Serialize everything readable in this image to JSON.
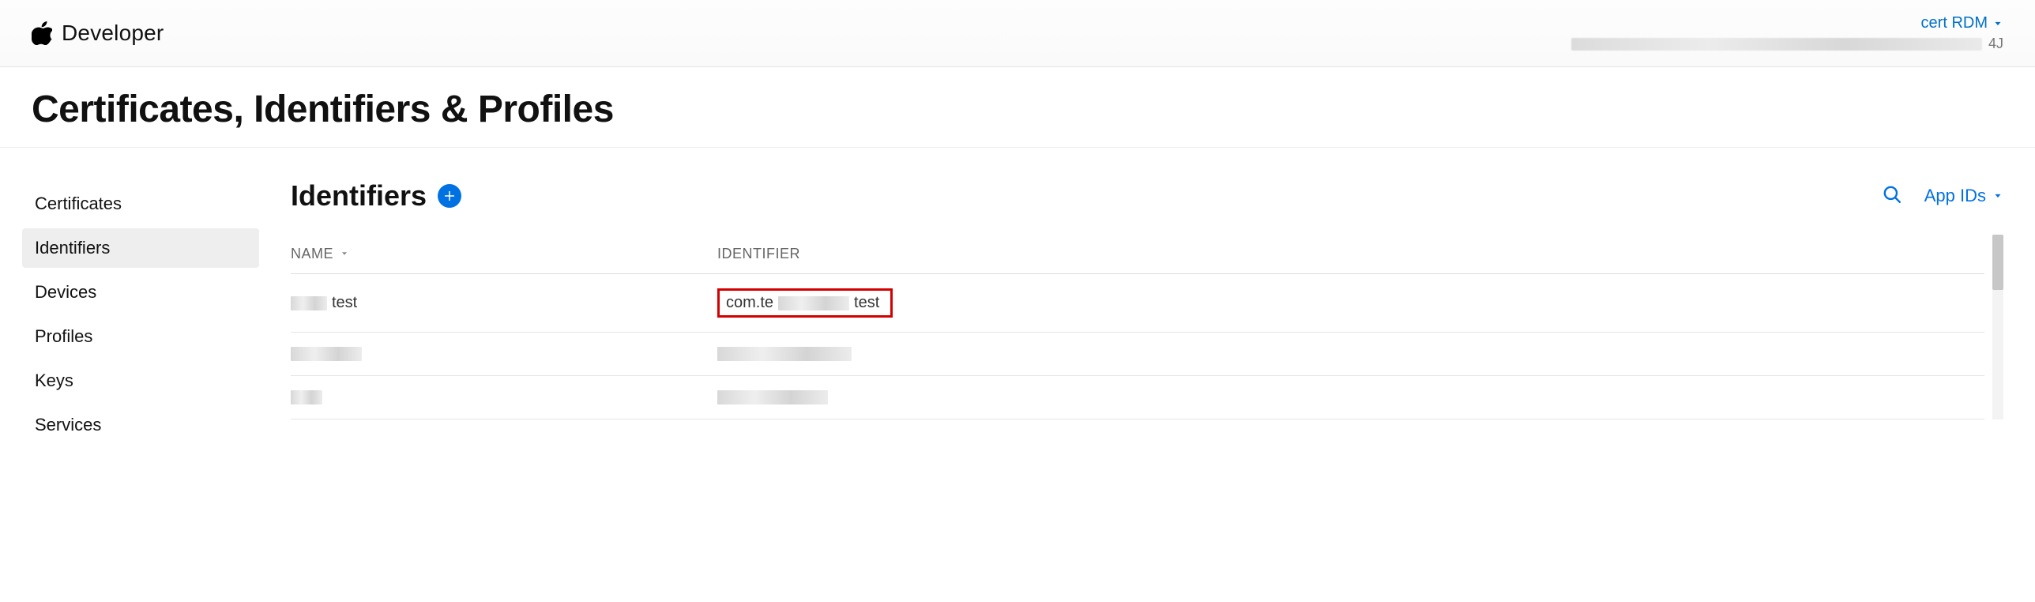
{
  "header": {
    "brand": "Developer",
    "account_name": "cert RDM",
    "team_suffix": "4J"
  },
  "page_title": "Certificates, Identifiers & Profiles",
  "sidebar": {
    "items": [
      {
        "label": "Certificates",
        "active": false
      },
      {
        "label": "Identifiers",
        "active": true
      },
      {
        "label": "Devices",
        "active": false
      },
      {
        "label": "Profiles",
        "active": false
      },
      {
        "label": "Keys",
        "active": false
      },
      {
        "label": "Services",
        "active": false
      }
    ]
  },
  "main": {
    "section_title": "Identifiers",
    "filter_label": "App IDs",
    "columns": {
      "name": "NAME",
      "identifier": "IDENTIFIER"
    },
    "rows": [
      {
        "name_suffix": "test",
        "id_prefix": "com.te",
        "id_suffix": "test",
        "highlighted": true
      },
      {
        "highlighted": false
      },
      {
        "highlighted": false
      }
    ]
  }
}
